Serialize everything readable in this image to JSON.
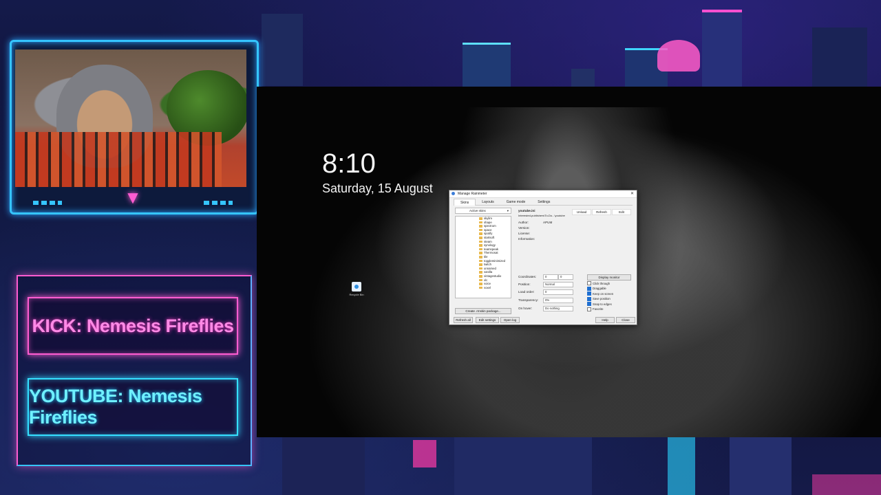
{
  "overlay": {
    "kick_label": "KICK: Nemesis Fireflies",
    "youtube_label": "YOUTUBE: Nemesis Fireflies",
    "colors": {
      "pink_neon": "#ff5cd1",
      "cyan_neon": "#35e0ff",
      "frame_blue": "#35c5ff"
    }
  },
  "desktop": {
    "time": "8:10",
    "date": "Saturday, 15 August",
    "icon_label": "Recycle Bin"
  },
  "window": {
    "title": "Manage Rainmeter",
    "tabs": [
      "Skins",
      "Layouts",
      "Game mode",
      "Settings"
    ],
    "active_skins_select": "Active skins",
    "tree_items": [
      "skylim",
      "shape",
      "spectrum",
      "space",
      "spotify",
      "startsoft",
      "steam",
      "synology",
      "teamspeak",
      "Thermosat",
      "tile",
      "toggleminimized",
      "twitch",
      "unnamed",
      "vanilla",
      "vintagestudio",
      "vlc",
      "voice",
      "voxel"
    ],
    "create_package_button": "Create .rmskin package...",
    "skin_name": "youtube.ini",
    "skin_path": "Interested-publishers\\To-Do...\\youtube",
    "meta_labels": [
      "Author:",
      "Version:",
      "License:",
      "Information:"
    ],
    "author": "APUM",
    "buttons": {
      "unload": "Unload",
      "refresh": "Refresh",
      "edit": "Edit"
    },
    "coord_label": "Coordinates:",
    "coord_x": "0",
    "coord_y": "0",
    "display_monitor_button": "Display monitor",
    "position_label": "Position:",
    "position_value": "Normal",
    "load_order_label": "Load order:",
    "load_order_value": "0",
    "transparency_label": "Transparency:",
    "transparency_value": "0%",
    "onhover_label": "On hover:",
    "onhover_value": "Do nothing",
    "checkboxes": [
      {
        "label": "Click through",
        "checked": false
      },
      {
        "label": "Draggable",
        "checked": true
      },
      {
        "label": "Keep on screen",
        "checked": true
      },
      {
        "label": "Save position",
        "checked": true
      },
      {
        "label": "Snap to edges",
        "checked": true
      },
      {
        "label": "Favorite",
        "checked": false
      }
    ],
    "bottom_buttons": {
      "refresh_all": "Refresh all",
      "edit_settings": "Edit settings",
      "open_log": "Open log",
      "help": "Help",
      "close": "Close"
    }
  }
}
